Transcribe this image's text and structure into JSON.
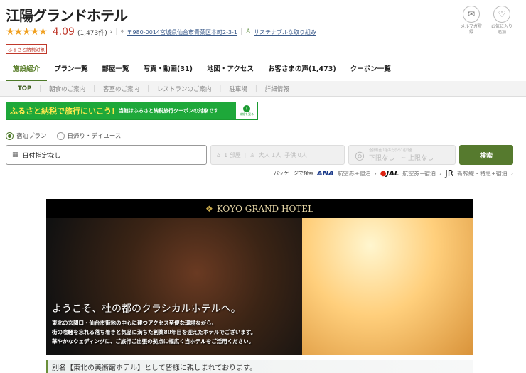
{
  "hotel": {
    "name": "江陽グランドホテル",
    "stars": "★★★★★",
    "score": "4.09",
    "review_count": "(1,473件)",
    "address": "〒980-0014宮城県仙台市青葉区本町2-3-1",
    "sustainable": "サステナブルな取り組み",
    "badge": "ふるさと納税対象"
  },
  "actions": {
    "mail": "メルマガ登録",
    "fav": "お気に入り追加"
  },
  "tabs": [
    "施設紹介",
    "プラン一覧",
    "部屋一覧",
    "写真・動画(31)",
    "地図・アクセス",
    "お客さまの声(1,473)",
    "クーポン一覧"
  ],
  "subnav": [
    "TOP",
    "朝食のご案内",
    "客室のご案内",
    "レストランのご案内",
    "駐車場",
    "詳細情報"
  ],
  "banner": {
    "big": "ふるさと納税で旅行にいこう!",
    "text": "当館はふるさと納税旅行クーポンの対象です",
    "more": "詳細を見る"
  },
  "search": {
    "radio1": "宿泊プラン",
    "radio2": "日帰り・デイユース",
    "date": "日付指定なし",
    "rooms": "1 部屋",
    "adults": "大人 1人",
    "children": "子供 0人",
    "price_label": "合計料金 1泊あたりの1名料金",
    "price_min": "下限なし",
    "price_tilde": "~",
    "price_max": "上限なし",
    "button": "検索"
  },
  "package": {
    "label": "パッケージで検索",
    "ana": "ANA",
    "ana_link": "航空券+宿泊",
    "jal": "JAL",
    "jal_link": "航空券+宿泊",
    "jr": "JR",
    "jr_link": "新幹線・特急+宿泊"
  },
  "hero": {
    "logo": "KOYO GRAND HOTEL",
    "headline": "ようこそ、杜の都のクラシカルホテルへ。",
    "line1": "東北の玄関口・仙台市街地の中心に建つアクセス至便な環境ながら、",
    "line2": "街の喧騒を忘れる落ち着きと気品に満ちた創業80年目を迎えたホテルでございます。",
    "line3": "華やかなウェディングに、ご旅行ご出張の拠点に幅広く当ホテルをご活用ください。"
  },
  "caption": "別名【東北の美術館ホテル】として皆様に親しまれております。",
  "colors": {
    "accent": "#567a2e",
    "score": "#c0392b",
    "banner": "#1ea83a"
  }
}
